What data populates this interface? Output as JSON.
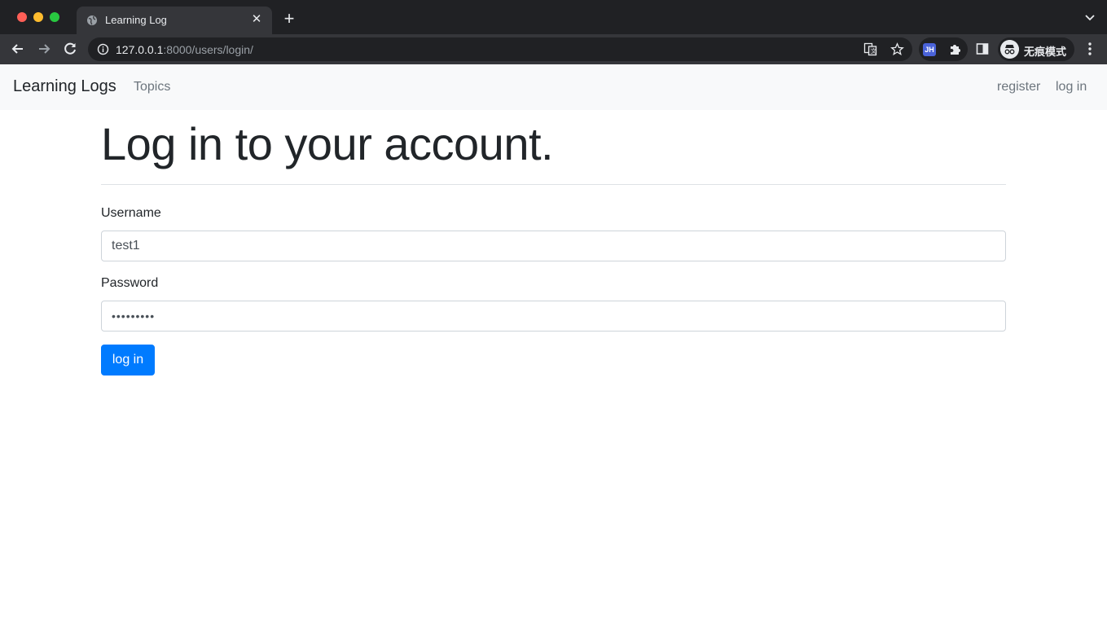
{
  "browser": {
    "tab_title": "Learning Log",
    "url_host": "127.0.0.1",
    "url_path": ":8000/users/login/",
    "extension_badge": "JH",
    "incognito_label": "无痕模式"
  },
  "navbar": {
    "brand": "Learning Logs",
    "topics": "Topics",
    "register": "register",
    "login": "log in"
  },
  "main": {
    "title": "Log in to your account.",
    "username_label": "Username",
    "username_value": "test1",
    "password_label": "Password",
    "password_value": "•••••••••",
    "submit_label": "log in"
  },
  "colors": {
    "primary": "#007bff",
    "navbar_bg": "#f8f9fa",
    "chrome_bg": "#202124"
  }
}
